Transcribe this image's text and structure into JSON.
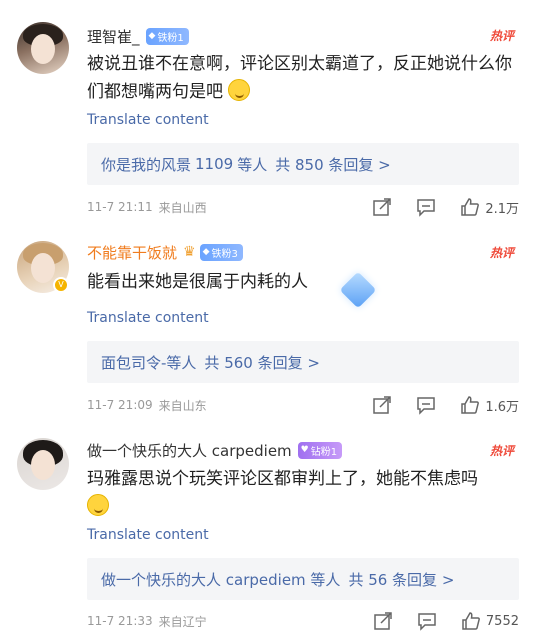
{
  "comments": [
    {
      "username": "理智崔_",
      "badge": "铁粉1",
      "hot": "热评",
      "text": "被说丑谁不在意啊，评论区别太霸道了，反正她说什么你们都想嘴两句是吧",
      "translate": "Translate content",
      "reply_user": "你是我的风景",
      "reply_count": "1109",
      "reply_suffix": "等人",
      "reply_total": "共 850 条回复 >",
      "time": "11-7 21:11",
      "location": "来自山西",
      "likes": "2.1万"
    },
    {
      "username": "不能靠干饭就",
      "badge": "铁粉3",
      "hot": "热评",
      "text": "能看出来她是很属于内耗的人",
      "translate": "Translate content",
      "reply_user": "面包司令-等人",
      "reply_total": "共 560 条回复 >",
      "time": "11-7 21:09",
      "location": "来自山东",
      "likes": "1.6万"
    },
    {
      "username": "做一个快乐的大人 carpediem",
      "badge": "钻粉1",
      "hot": "热评",
      "text": "玛雅露思说个玩笑评论区都审判上了，她能不焦虑吗",
      "translate": "Translate content",
      "reply_user": "做一个快乐的大人 carpediem 等人",
      "reply_total": "共 56 条回复 >",
      "time": "11-7 21:33",
      "location": "来自辽宁",
      "likes": "7552"
    }
  ],
  "icons": {
    "share": "share-icon",
    "comment": "comment-icon",
    "like": "like-icon"
  },
  "colors": {
    "link": "#4a6aa8",
    "hot": "#ef4a3a",
    "username_highlight": "#f07c1e"
  }
}
